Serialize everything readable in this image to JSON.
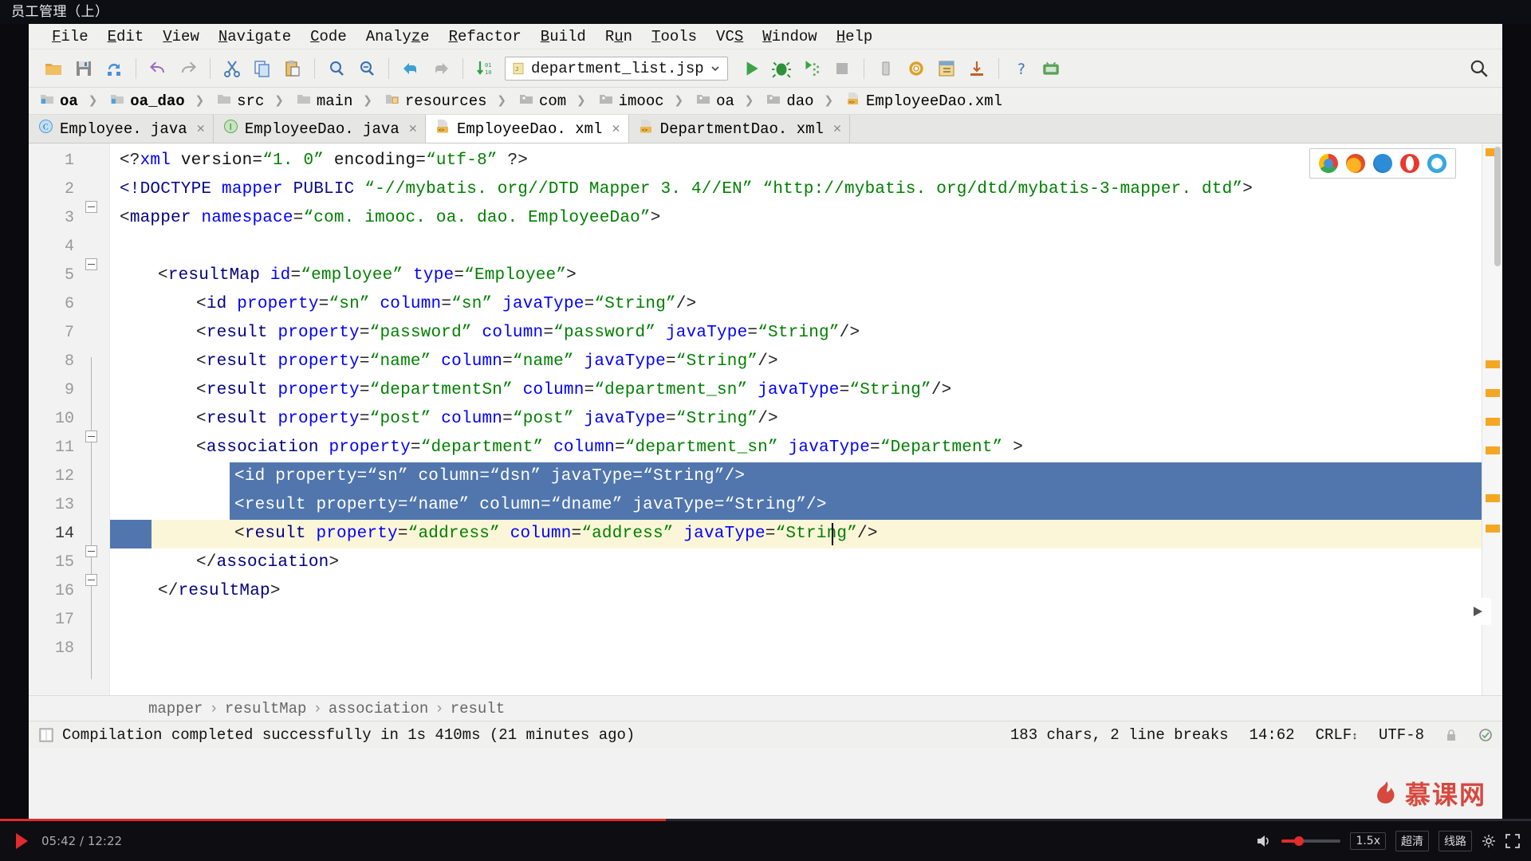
{
  "video": {
    "title": "员工管理（上）",
    "current_time": "05:42",
    "total_time": "12:22",
    "play_icon": "play-icon",
    "volume_icon": "volume-icon",
    "speed_label": "1.5x",
    "quality_label": "超清",
    "route_label": "线路",
    "settings_icon": "gear-icon",
    "fullscreen_icon": "fullscreen-icon",
    "progress_percent": 43.5
  },
  "watermark": {
    "text": "慕课网"
  },
  "menu": {
    "items": [
      {
        "mnemonic": "F",
        "rest": "ile"
      },
      {
        "mnemonic": "E",
        "rest": "dit"
      },
      {
        "mnemonic": "V",
        "rest": "iew"
      },
      {
        "mnemonic": "N",
        "rest": "avigate"
      },
      {
        "mnemonic": "C",
        "rest": "ode"
      },
      {
        "mnemonic": "z",
        "rest": "Analyze",
        "pre": "Analy",
        "post": "e"
      },
      {
        "mnemonic": "R",
        "rest": "efactor"
      },
      {
        "mnemonic": "B",
        "rest": "uild"
      },
      {
        "mnemonic": "u",
        "rest": "Run",
        "pre": "R",
        "post": "n"
      },
      {
        "mnemonic": "T",
        "rest": "ools"
      },
      {
        "mnemonic": "S",
        "rest": "VCS",
        "pre": "VC",
        "post": ""
      },
      {
        "mnemonic": "W",
        "rest": "indow"
      },
      {
        "mnemonic": "H",
        "rest": "elp"
      }
    ]
  },
  "toolbar": {
    "buttons": [
      "open-folder-icon",
      "save-icon",
      "sync-icon",
      "undo-icon",
      "redo-icon",
      "cut-icon",
      "copy-icon",
      "paste-icon",
      "find-icon",
      "replace-icon",
      "navigate-back-icon",
      "navigate-forward-icon",
      "sort-icon"
    ],
    "run_config": "department_list.jsp",
    "run_config_icon": "jsp-file-icon",
    "run_icon": "run-icon",
    "debug_icon": "debug-icon",
    "coverage_icon": "coverage-icon",
    "stop_icon": "stop-icon",
    "restart_icon": "restart-icon",
    "settings_icon": "gear-icon",
    "project_structure_icon": "project-structure-icon",
    "update_icon": "update-icon",
    "help_icon": "help-icon",
    "android_icon": "android-device-icon",
    "search_everywhere_icon": "search-icon"
  },
  "breadcrumbs": {
    "items": [
      {
        "label": "oa",
        "icon": "module-icon",
        "bold": true
      },
      {
        "label": "oa_dao",
        "icon": "module-icon",
        "bold": true
      },
      {
        "label": "src",
        "icon": "folder-icon",
        "bold": false
      },
      {
        "label": "main",
        "icon": "folder-icon",
        "bold": false
      },
      {
        "label": "resources",
        "icon": "resources-folder-icon",
        "bold": false
      },
      {
        "label": "com",
        "icon": "package-icon",
        "bold": false
      },
      {
        "label": "imooc",
        "icon": "package-icon",
        "bold": false
      },
      {
        "label": "oa",
        "icon": "package-icon",
        "bold": false
      },
      {
        "label": "dao",
        "icon": "package-icon",
        "bold": false
      },
      {
        "label": "EmployeeDao.xml",
        "icon": "xml-file-icon",
        "bold": false
      }
    ]
  },
  "tabs": [
    {
      "label": "Employee. java",
      "icon": "java-class-icon",
      "active": false,
      "closable": true
    },
    {
      "label": "EmployeeDao. java",
      "icon": "java-interface-icon",
      "active": false,
      "closable": true
    },
    {
      "label": "EmployeeDao. xml",
      "icon": "xml-file-icon",
      "active": true,
      "closable": true
    },
    {
      "label": "DepartmentDao. xml",
      "icon": "xml-file-icon",
      "active": false,
      "closable": true
    }
  ],
  "editor": {
    "line_numbers": [
      "1",
      "2",
      "3",
      "4",
      "5",
      "6",
      "7",
      "8",
      "9",
      "10",
      "11",
      "12",
      "13",
      "14",
      "15",
      "16",
      "17",
      "18"
    ],
    "current_line": 14,
    "lines": [
      {
        "n": 1,
        "indent": 0,
        "selected": false,
        "tokens": [
          {
            "t": "<?",
            "c": "punct"
          },
          {
            "t": "xml",
            "c": "attr"
          },
          {
            "t": " version=",
            "c": "plain"
          },
          {
            "t": "“1. 0”",
            "c": "val"
          },
          {
            "t": " encoding=",
            "c": "plain"
          },
          {
            "t": "“utf-8”",
            "c": "val"
          },
          {
            "t": " ?>",
            "c": "punct"
          }
        ]
      },
      {
        "n": 2,
        "indent": 0,
        "selected": false,
        "tokens": [
          {
            "t": "<!DOCTYPE ",
            "c": "doc"
          },
          {
            "t": "mapper",
            "c": "attr"
          },
          {
            "t": " PUBLIC ",
            "c": "doc"
          },
          {
            "t": "“-//mybatis. org//DTD Mapper 3. 4//EN”",
            "c": "val"
          },
          {
            "t": " ",
            "c": "plain"
          },
          {
            "t": "“http://mybatis. org/dtd/mybatis-3-mapper. dtd”",
            "c": "val"
          },
          {
            "t": ">",
            "c": "punct"
          }
        ]
      },
      {
        "n": 3,
        "indent": 0,
        "selected": false,
        "tokens": [
          {
            "t": "<",
            "c": "punct"
          },
          {
            "t": "mapper",
            "c": "tag"
          },
          {
            "t": " ",
            "c": "plain"
          },
          {
            "t": "namespace",
            "c": "attr"
          },
          {
            "t": "=",
            "c": "punct"
          },
          {
            "t": "“com. imooc. oa. dao. EmployeeDao”",
            "c": "val"
          },
          {
            "t": ">",
            "c": "punct"
          }
        ]
      },
      {
        "n": 4,
        "indent": 0,
        "selected": false,
        "tokens": []
      },
      {
        "n": 5,
        "indent": 1,
        "selected": false,
        "tokens": [
          {
            "t": "<",
            "c": "punct"
          },
          {
            "t": "resultMap",
            "c": "tag"
          },
          {
            "t": " ",
            "c": "plain"
          },
          {
            "t": "id",
            "c": "attr"
          },
          {
            "t": "=",
            "c": "punct"
          },
          {
            "t": "“employee”",
            "c": "val"
          },
          {
            "t": " ",
            "c": "plain"
          },
          {
            "t": "type",
            "c": "attr"
          },
          {
            "t": "=",
            "c": "punct"
          },
          {
            "t": "“Employee”",
            "c": "val"
          },
          {
            "t": ">",
            "c": "punct"
          }
        ]
      },
      {
        "n": 6,
        "indent": 2,
        "selected": false,
        "tokens": [
          {
            "t": "<",
            "c": "punct"
          },
          {
            "t": "id",
            "c": "tag"
          },
          {
            "t": " ",
            "c": "plain"
          },
          {
            "t": "property",
            "c": "attr"
          },
          {
            "t": "=",
            "c": "punct"
          },
          {
            "t": "“sn”",
            "c": "val"
          },
          {
            "t": " ",
            "c": "plain"
          },
          {
            "t": "column",
            "c": "attr"
          },
          {
            "t": "=",
            "c": "punct"
          },
          {
            "t": "“sn”",
            "c": "val"
          },
          {
            "t": " ",
            "c": "plain"
          },
          {
            "t": "javaType",
            "c": "attr"
          },
          {
            "t": "=",
            "c": "punct"
          },
          {
            "t": "“String”",
            "c": "val"
          },
          {
            "t": "/>",
            "c": "punct"
          }
        ]
      },
      {
        "n": 7,
        "indent": 2,
        "selected": false,
        "tokens": [
          {
            "t": "<",
            "c": "punct"
          },
          {
            "t": "result",
            "c": "tag"
          },
          {
            "t": " ",
            "c": "plain"
          },
          {
            "t": "property",
            "c": "attr"
          },
          {
            "t": "=",
            "c": "punct"
          },
          {
            "t": "“password”",
            "c": "val"
          },
          {
            "t": " ",
            "c": "plain"
          },
          {
            "t": "column",
            "c": "attr"
          },
          {
            "t": "=",
            "c": "punct"
          },
          {
            "t": "“password”",
            "c": "val"
          },
          {
            "t": " ",
            "c": "plain"
          },
          {
            "t": "javaType",
            "c": "attr"
          },
          {
            "t": "=",
            "c": "punct"
          },
          {
            "t": "“String”",
            "c": "val"
          },
          {
            "t": "/>",
            "c": "punct"
          }
        ]
      },
      {
        "n": 8,
        "indent": 2,
        "selected": false,
        "tokens": [
          {
            "t": "<",
            "c": "punct"
          },
          {
            "t": "result",
            "c": "tag"
          },
          {
            "t": " ",
            "c": "plain"
          },
          {
            "t": "property",
            "c": "attr"
          },
          {
            "t": "=",
            "c": "punct"
          },
          {
            "t": "“name”",
            "c": "val"
          },
          {
            "t": " ",
            "c": "plain"
          },
          {
            "t": "column",
            "c": "attr"
          },
          {
            "t": "=",
            "c": "punct"
          },
          {
            "t": "“name”",
            "c": "val"
          },
          {
            "t": " ",
            "c": "plain"
          },
          {
            "t": "javaType",
            "c": "attr"
          },
          {
            "t": "=",
            "c": "punct"
          },
          {
            "t": "“String”",
            "c": "val"
          },
          {
            "t": "/>",
            "c": "punct"
          }
        ]
      },
      {
        "n": 9,
        "indent": 2,
        "selected": false,
        "tokens": [
          {
            "t": "<",
            "c": "punct"
          },
          {
            "t": "result",
            "c": "tag"
          },
          {
            "t": " ",
            "c": "plain"
          },
          {
            "t": "property",
            "c": "attr"
          },
          {
            "t": "=",
            "c": "punct"
          },
          {
            "t": "“departmentSn”",
            "c": "val"
          },
          {
            "t": " ",
            "c": "plain"
          },
          {
            "t": "column",
            "c": "attr"
          },
          {
            "t": "=",
            "c": "punct"
          },
          {
            "t": "“department_sn”",
            "c": "val"
          },
          {
            "t": " ",
            "c": "plain"
          },
          {
            "t": "javaType",
            "c": "attr"
          },
          {
            "t": "=",
            "c": "punct"
          },
          {
            "t": "“String”",
            "c": "val"
          },
          {
            "t": "/>",
            "c": "punct"
          }
        ]
      },
      {
        "n": 10,
        "indent": 2,
        "selected": false,
        "tokens": [
          {
            "t": "<",
            "c": "punct"
          },
          {
            "t": "result",
            "c": "tag"
          },
          {
            "t": " ",
            "c": "plain"
          },
          {
            "t": "property",
            "c": "attr"
          },
          {
            "t": "=",
            "c": "punct"
          },
          {
            "t": "“post”",
            "c": "val"
          },
          {
            "t": " ",
            "c": "plain"
          },
          {
            "t": "column",
            "c": "attr"
          },
          {
            "t": "=",
            "c": "punct"
          },
          {
            "t": "“post”",
            "c": "val"
          },
          {
            "t": " ",
            "c": "plain"
          },
          {
            "t": "javaType",
            "c": "attr"
          },
          {
            "t": "=",
            "c": "punct"
          },
          {
            "t": "“String”",
            "c": "val"
          },
          {
            "t": "/>",
            "c": "punct"
          }
        ]
      },
      {
        "n": 11,
        "indent": 2,
        "selected": false,
        "tokens": [
          {
            "t": "<",
            "c": "punct"
          },
          {
            "t": "association",
            "c": "tag"
          },
          {
            "t": " ",
            "c": "plain"
          },
          {
            "t": "property",
            "c": "attr"
          },
          {
            "t": "=",
            "c": "punct"
          },
          {
            "t": "“department”",
            "c": "val"
          },
          {
            "t": " ",
            "c": "plain"
          },
          {
            "t": "column",
            "c": "attr"
          },
          {
            "t": "=",
            "c": "punct"
          },
          {
            "t": "“department_sn”",
            "c": "val"
          },
          {
            "t": " ",
            "c": "plain"
          },
          {
            "t": "javaType",
            "c": "attr"
          },
          {
            "t": "=",
            "c": "punct"
          },
          {
            "t": "“Department”",
            "c": "val"
          },
          {
            "t": " >",
            "c": "punct"
          }
        ]
      },
      {
        "n": 12,
        "indent": 3,
        "selected": true,
        "tokens": [
          {
            "t": "<",
            "c": "punct"
          },
          {
            "t": "id",
            "c": "tag"
          },
          {
            "t": " ",
            "c": "plain"
          },
          {
            "t": "property",
            "c": "attr"
          },
          {
            "t": "=",
            "c": "punct"
          },
          {
            "t": "“sn”",
            "c": "val"
          },
          {
            "t": " ",
            "c": "plain"
          },
          {
            "t": "column",
            "c": "attr"
          },
          {
            "t": "=",
            "c": "punct"
          },
          {
            "t": "“dsn”",
            "c": "val"
          },
          {
            "t": " ",
            "c": "plain"
          },
          {
            "t": "javaType",
            "c": "attr"
          },
          {
            "t": "=",
            "c": "punct"
          },
          {
            "t": "“String”",
            "c": "val"
          },
          {
            "t": "/>",
            "c": "punct"
          }
        ]
      },
      {
        "n": 13,
        "indent": 3,
        "selected": true,
        "tokens": [
          {
            "t": "<",
            "c": "punct"
          },
          {
            "t": "result",
            "c": "tag"
          },
          {
            "t": " ",
            "c": "plain"
          },
          {
            "t": "property",
            "c": "attr"
          },
          {
            "t": "=",
            "c": "punct"
          },
          {
            "t": "“name”",
            "c": "val"
          },
          {
            "t": " ",
            "c": "plain"
          },
          {
            "t": "column",
            "c": "attr"
          },
          {
            "t": "=",
            "c": "punct"
          },
          {
            "t": "“dname”",
            "c": "val"
          },
          {
            "t": " ",
            "c": "plain"
          },
          {
            "t": "javaType",
            "c": "attr"
          },
          {
            "t": "=",
            "c": "punct"
          },
          {
            "t": "“String”",
            "c": "val"
          },
          {
            "t": "/>",
            "c": "punct"
          }
        ]
      },
      {
        "n": 14,
        "indent": 3,
        "selected": false,
        "tokens": [
          {
            "t": "<",
            "c": "punct"
          },
          {
            "t": "result",
            "c": "tag"
          },
          {
            "t": " ",
            "c": "plain"
          },
          {
            "t": "property",
            "c": "attr"
          },
          {
            "t": "=",
            "c": "punct"
          },
          {
            "t": "“address”",
            "c": "val"
          },
          {
            "t": " ",
            "c": "plain"
          },
          {
            "t": "column",
            "c": "attr"
          },
          {
            "t": "=",
            "c": "punct"
          },
          {
            "t": "“address”",
            "c": "val"
          },
          {
            "t": " ",
            "c": "plain"
          },
          {
            "t": "javaType",
            "c": "attr"
          },
          {
            "t": "=",
            "c": "punct"
          },
          {
            "t": "“String”",
            "c": "val"
          },
          {
            "t": "/>",
            "c": "punct"
          }
        ]
      },
      {
        "n": 15,
        "indent": 2,
        "selected": false,
        "tokens": [
          {
            "t": "</",
            "c": "punct"
          },
          {
            "t": "association",
            "c": "tag"
          },
          {
            "t": ">",
            "c": "punct"
          }
        ]
      },
      {
        "n": 16,
        "indent": 1,
        "selected": false,
        "tokens": [
          {
            "t": "</",
            "c": "punct"
          },
          {
            "t": "resultMap",
            "c": "tag"
          },
          {
            "t": ">",
            "c": "punct"
          }
        ]
      },
      {
        "n": 17,
        "indent": 0,
        "selected": false,
        "tokens": []
      },
      {
        "n": 18,
        "indent": 0,
        "selected": false,
        "tokens": []
      }
    ]
  },
  "browser_popup": {
    "icons": [
      "chrome-icon",
      "firefox-icon",
      "edge-icon",
      "opera-icon",
      "safari-icon"
    ]
  },
  "structure_bar": {
    "path": [
      "mapper",
      "resultMap",
      "association",
      "result"
    ],
    "separator": "›"
  },
  "status_bar": {
    "message": "Compilation completed successfully in 1s 410ms (21 minutes ago)",
    "message_icon": "build-icon",
    "char_count": "183 chars, 2 line breaks",
    "caret_position": "14:62",
    "line_separator": "CRLF",
    "encoding": "UTF-8",
    "lock_icon": "lock-icon",
    "inspection_icon": "inspection-icon"
  },
  "colors": {
    "tag": "#000080",
    "attribute": "#0000ff",
    "value": "#008000",
    "selection": "#5176ad",
    "current_line": "#fcf6d8",
    "accent_red": "#e02c2c",
    "warning_marker": "#f5a623"
  }
}
